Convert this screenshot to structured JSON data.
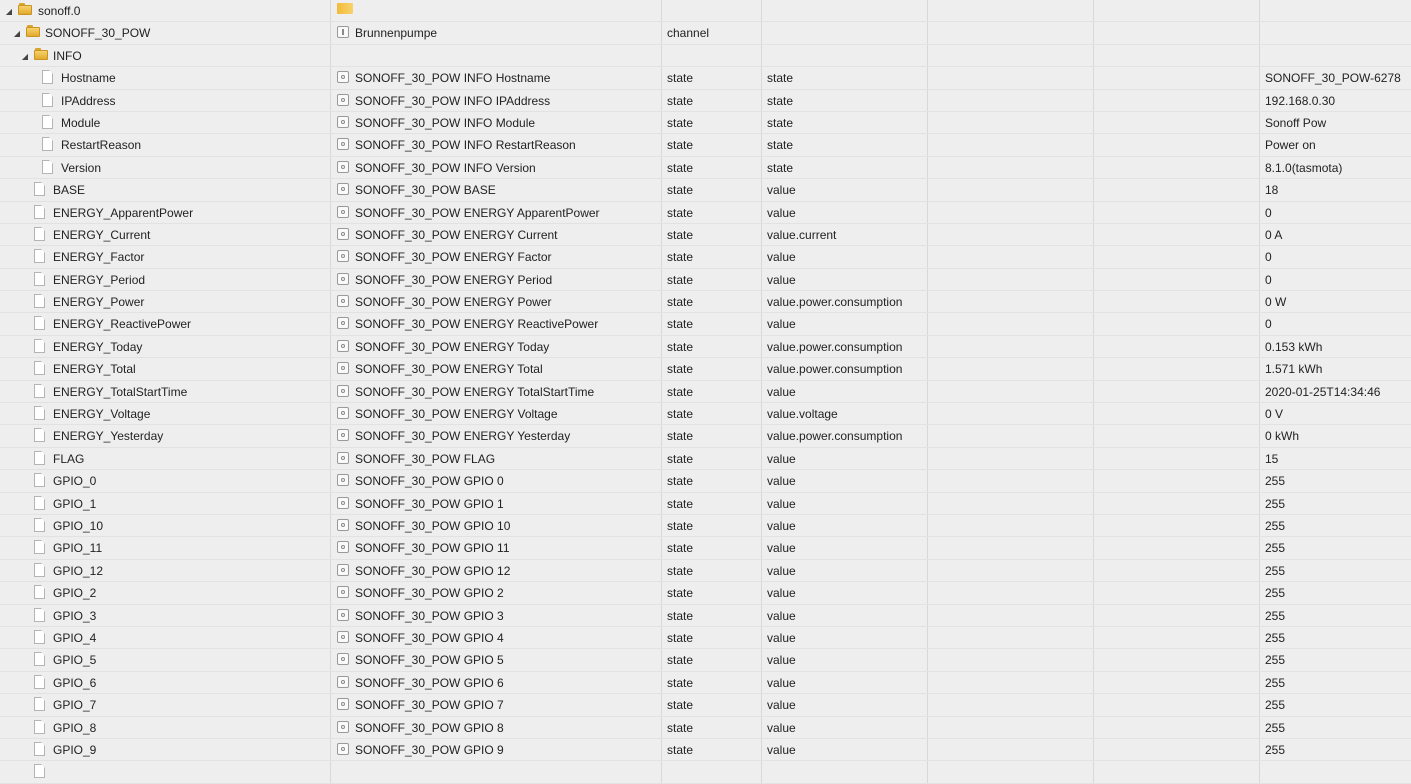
{
  "rows": [
    {
      "level": 0,
      "type": "folder",
      "expanded": true,
      "icon": "folder-icon",
      "name": "sonoff.0",
      "desc": "",
      "obj_type": "",
      "role": "",
      "value": "",
      "desc_icon": "adapter-icon"
    },
    {
      "level": 1,
      "type": "folder",
      "expanded": true,
      "icon": "folder-icon",
      "name": "SONOFF_30_POW",
      "desc": "Brunnenpumpe",
      "obj_type": "channel",
      "role": "",
      "value": "",
      "desc_icon": "channel-icon"
    },
    {
      "level": 2,
      "type": "folder",
      "expanded": true,
      "icon": "folder-icon",
      "name": "INFO",
      "desc": "",
      "obj_type": "",
      "role": "",
      "value": "",
      "desc_icon": ""
    },
    {
      "level": 3,
      "type": "state",
      "icon": "file-icon",
      "name": "Hostname",
      "desc": "SONOFF_30_POW INFO Hostname",
      "obj_type": "state",
      "role": "state",
      "value": "SONOFF_30_POW-6278",
      "desc_icon": "state-icon"
    },
    {
      "level": 3,
      "type": "state",
      "icon": "file-icon",
      "name": "IPAddress",
      "desc": "SONOFF_30_POW INFO IPAddress",
      "obj_type": "state",
      "role": "state",
      "value": "192.168.0.30",
      "desc_icon": "state-icon"
    },
    {
      "level": 3,
      "type": "state",
      "icon": "file-icon",
      "name": "Module",
      "desc": "SONOFF_30_POW INFO Module",
      "obj_type": "state",
      "role": "state",
      "value": "Sonoff Pow",
      "desc_icon": "state-icon"
    },
    {
      "level": 3,
      "type": "state",
      "icon": "file-icon",
      "name": "RestartReason",
      "desc": "SONOFF_30_POW INFO RestartReason",
      "obj_type": "state",
      "role": "state",
      "value": "Power on",
      "desc_icon": "state-icon"
    },
    {
      "level": 3,
      "type": "state",
      "icon": "file-icon",
      "name": "Version",
      "desc": "SONOFF_30_POW INFO Version",
      "obj_type": "state",
      "role": "state",
      "value": "8.1.0(tasmota)",
      "desc_icon": "state-icon"
    },
    {
      "level": 2,
      "type": "state",
      "icon": "file-icon",
      "name": "BASE",
      "desc": "SONOFF_30_POW BASE",
      "obj_type": "state",
      "role": "value",
      "value": "18",
      "desc_icon": "state-icon"
    },
    {
      "level": 2,
      "type": "state",
      "icon": "file-icon",
      "name": "ENERGY_ApparentPower",
      "desc": "SONOFF_30_POW ENERGY ApparentPower",
      "obj_type": "state",
      "role": "value",
      "value": "0",
      "desc_icon": "state-icon"
    },
    {
      "level": 2,
      "type": "state",
      "icon": "file-icon",
      "name": "ENERGY_Current",
      "desc": "SONOFF_30_POW ENERGY Current",
      "obj_type": "state",
      "role": "value.current",
      "value": "0 A",
      "desc_icon": "state-icon"
    },
    {
      "level": 2,
      "type": "state",
      "icon": "file-icon",
      "name": "ENERGY_Factor",
      "desc": "SONOFF_30_POW ENERGY Factor",
      "obj_type": "state",
      "role": "value",
      "value": "0",
      "desc_icon": "state-icon"
    },
    {
      "level": 2,
      "type": "state",
      "icon": "file-icon",
      "name": "ENERGY_Period",
      "desc": "SONOFF_30_POW ENERGY Period",
      "obj_type": "state",
      "role": "value",
      "value": "0",
      "desc_icon": "state-icon"
    },
    {
      "level": 2,
      "type": "state",
      "icon": "file-icon",
      "name": "ENERGY_Power",
      "desc": "SONOFF_30_POW ENERGY Power",
      "obj_type": "state",
      "role": "value.power.consumption",
      "value": "0 W",
      "desc_icon": "state-icon"
    },
    {
      "level": 2,
      "type": "state",
      "icon": "file-icon",
      "name": "ENERGY_ReactivePower",
      "desc": "SONOFF_30_POW ENERGY ReactivePower",
      "obj_type": "state",
      "role": "value",
      "value": "0",
      "desc_icon": "state-icon"
    },
    {
      "level": 2,
      "type": "state",
      "icon": "file-icon",
      "name": "ENERGY_Today",
      "desc": "SONOFF_30_POW ENERGY Today",
      "obj_type": "state",
      "role": "value.power.consumption",
      "value": "0.153 kWh",
      "desc_icon": "state-icon"
    },
    {
      "level": 2,
      "type": "state",
      "icon": "file-icon",
      "name": "ENERGY_Total",
      "desc": "SONOFF_30_POW ENERGY Total",
      "obj_type": "state",
      "role": "value.power.consumption",
      "value": "1.571 kWh",
      "desc_icon": "state-icon"
    },
    {
      "level": 2,
      "type": "state",
      "icon": "file-icon",
      "name": "ENERGY_TotalStartTime",
      "desc": "SONOFF_30_POW ENERGY TotalStartTime",
      "obj_type": "state",
      "role": "value",
      "value": "2020-01-25T14:34:46",
      "desc_icon": "state-icon"
    },
    {
      "level": 2,
      "type": "state",
      "icon": "file-icon",
      "name": "ENERGY_Voltage",
      "desc": "SONOFF_30_POW ENERGY Voltage",
      "obj_type": "state",
      "role": "value.voltage",
      "value": "0 V",
      "desc_icon": "state-icon"
    },
    {
      "level": 2,
      "type": "state",
      "icon": "file-icon",
      "name": "ENERGY_Yesterday",
      "desc": "SONOFF_30_POW ENERGY Yesterday",
      "obj_type": "state",
      "role": "value.power.consumption",
      "value": "0 kWh",
      "desc_icon": "state-icon"
    },
    {
      "level": 2,
      "type": "state",
      "icon": "file-icon",
      "name": "FLAG",
      "desc": "SONOFF_30_POW FLAG",
      "obj_type": "state",
      "role": "value",
      "value": "15",
      "desc_icon": "state-icon"
    },
    {
      "level": 2,
      "type": "state",
      "icon": "file-icon",
      "name": "GPIO_0",
      "desc": "SONOFF_30_POW GPIO 0",
      "obj_type": "state",
      "role": "value",
      "value": "255",
      "desc_icon": "state-icon"
    },
    {
      "level": 2,
      "type": "state",
      "icon": "file-icon",
      "name": "GPIO_1",
      "desc": "SONOFF_30_POW GPIO 1",
      "obj_type": "state",
      "role": "value",
      "value": "255",
      "desc_icon": "state-icon"
    },
    {
      "level": 2,
      "type": "state",
      "icon": "file-icon",
      "name": "GPIO_10",
      "desc": "SONOFF_30_POW GPIO 10",
      "obj_type": "state",
      "role": "value",
      "value": "255",
      "desc_icon": "state-icon"
    },
    {
      "level": 2,
      "type": "state",
      "icon": "file-icon",
      "name": "GPIO_11",
      "desc": "SONOFF_30_POW GPIO 11",
      "obj_type": "state",
      "role": "value",
      "value": "255",
      "desc_icon": "state-icon"
    },
    {
      "level": 2,
      "type": "state",
      "icon": "file-icon",
      "name": "GPIO_12",
      "desc": "SONOFF_30_POW GPIO 12",
      "obj_type": "state",
      "role": "value",
      "value": "255",
      "desc_icon": "state-icon"
    },
    {
      "level": 2,
      "type": "state",
      "icon": "file-icon",
      "name": "GPIO_2",
      "desc": "SONOFF_30_POW GPIO 2",
      "obj_type": "state",
      "role": "value",
      "value": "255",
      "desc_icon": "state-icon"
    },
    {
      "level": 2,
      "type": "state",
      "icon": "file-icon",
      "name": "GPIO_3",
      "desc": "SONOFF_30_POW GPIO 3",
      "obj_type": "state",
      "role": "value",
      "value": "255",
      "desc_icon": "state-icon"
    },
    {
      "level": 2,
      "type": "state",
      "icon": "file-icon",
      "name": "GPIO_4",
      "desc": "SONOFF_30_POW GPIO 4",
      "obj_type": "state",
      "role": "value",
      "value": "255",
      "desc_icon": "state-icon"
    },
    {
      "level": 2,
      "type": "state",
      "icon": "file-icon",
      "name": "GPIO_5",
      "desc": "SONOFF_30_POW GPIO 5",
      "obj_type": "state",
      "role": "value",
      "value": "255",
      "desc_icon": "state-icon"
    },
    {
      "level": 2,
      "type": "state",
      "icon": "file-icon",
      "name": "GPIO_6",
      "desc": "SONOFF_30_POW GPIO 6",
      "obj_type": "state",
      "role": "value",
      "value": "255",
      "desc_icon": "state-icon"
    },
    {
      "level": 2,
      "type": "state",
      "icon": "file-icon",
      "name": "GPIO_7",
      "desc": "SONOFF_30_POW GPIO 7",
      "obj_type": "state",
      "role": "value",
      "value": "255",
      "desc_icon": "state-icon"
    },
    {
      "level": 2,
      "type": "state",
      "icon": "file-icon",
      "name": "GPIO_8",
      "desc": "SONOFF_30_POW GPIO 8",
      "obj_type": "state",
      "role": "value",
      "value": "255",
      "desc_icon": "state-icon"
    },
    {
      "level": 2,
      "type": "state",
      "icon": "file-icon",
      "name": "GPIO_9",
      "desc": "SONOFF_30_POW GPIO 9",
      "obj_type": "state",
      "role": "value",
      "value": "255",
      "desc_icon": "state-icon"
    },
    {
      "level": 2,
      "type": "state",
      "icon": "file-icon",
      "name": "",
      "desc": "",
      "obj_type": "",
      "role": "",
      "value": "",
      "desc_icon": ""
    }
  ]
}
